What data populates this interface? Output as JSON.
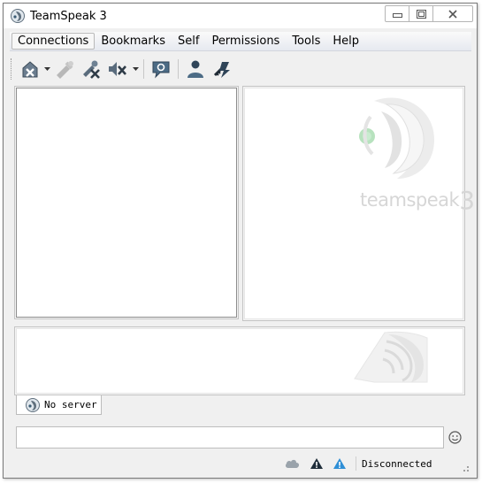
{
  "window": {
    "title": "TeamSpeak 3"
  },
  "titlebar": {
    "buttons": [
      {
        "name": "minimize-icon"
      },
      {
        "name": "maximize-icon"
      },
      {
        "name": "close-icon"
      }
    ]
  },
  "menubar": {
    "items": [
      "Connections",
      "Bookmarks",
      "Self",
      "Permissions",
      "Tools",
      "Help"
    ],
    "active_item": "Connections"
  },
  "toolbar": {
    "buttons": [
      {
        "icon": "disconnect-icon",
        "has_dropdown": true
      },
      {
        "icon": "away-icon",
        "disabled": true
      },
      {
        "icon": "mute-microphone-icon"
      },
      {
        "icon": "mute-speakers-icon",
        "has_dropdown": true
      },
      {
        "icon": "chat-bubble-icon"
      },
      {
        "icon": "contacts-icon"
      },
      {
        "icon": "identity-key-icon"
      }
    ]
  },
  "info_panel": {
    "logo_text": "teamspeak",
    "logo_number": "3"
  },
  "tabs": [
    {
      "label": "No server",
      "icon": "teamspeak-icon"
    }
  ],
  "chat_input": {
    "value": "",
    "placeholder": ""
  },
  "statusbar": {
    "icons": [
      "cloud-icon",
      "warning-dark-icon",
      "warning-blue-icon"
    ],
    "status_text": "Disconnected"
  },
  "colors": {
    "accent": "#3a7bd5",
    "menubar_bg": "#e6e9f0",
    "window_bg": "#f0f0f0"
  }
}
